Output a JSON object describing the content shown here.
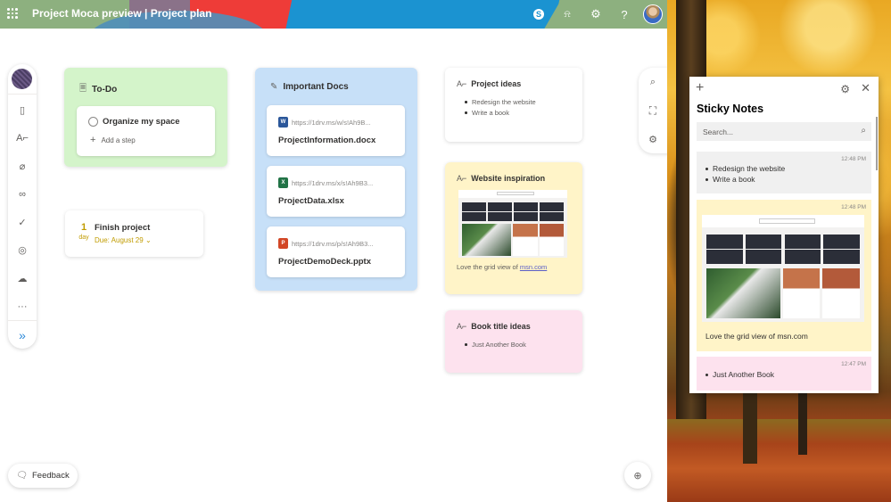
{
  "header": {
    "title": "Project Moca preview | Project plan",
    "icons": [
      "waffle-icon",
      "skype-icon",
      "bell-icon",
      "gear-icon",
      "help-icon",
      "avatar"
    ],
    "skype_glyph": "S",
    "bell_glyph": "🔔",
    "gear_glyph": "⚙",
    "help_glyph": "?"
  },
  "rail": {
    "items": [
      {
        "name": "contact-card-icon",
        "glyph": "▯"
      },
      {
        "name": "text-note-icon",
        "glyph": "A⌐"
      },
      {
        "name": "attachment-icon",
        "glyph": "⌀"
      },
      {
        "name": "link-icon",
        "glyph": "∞"
      },
      {
        "name": "task-check-icon",
        "glyph": "✓"
      },
      {
        "name": "goal-target-icon",
        "glyph": "◎"
      },
      {
        "name": "weather-icon",
        "glyph": "☁"
      },
      {
        "name": "more-icon",
        "glyph": "···"
      }
    ],
    "expand_glyph": "»"
  },
  "todo": {
    "title": "To-Do",
    "task": "Organize my space",
    "add_step": "Add a step"
  },
  "task_card": {
    "days_count": "1",
    "days_unit": "day",
    "title": "Finish project",
    "due": "Due: August 29"
  },
  "docs": {
    "title": "Important Docs",
    "items": [
      {
        "url": "https://1drv.ms/w/s!Ah9B...",
        "name": "ProjectInformation.docx",
        "type": "word",
        "color": "#2b579a",
        "letter": "W"
      },
      {
        "url": "https://1drv.ms/x/s!Ah9B3...",
        "name": "ProjectData.xlsx",
        "type": "excel",
        "color": "#217346",
        "letter": "X"
      },
      {
        "url": "https://1drv.ms/p/s!Ah9B3...",
        "name": "ProjectDemoDeck.pptx",
        "type": "powerpoint",
        "color": "#d24726",
        "letter": "P"
      }
    ]
  },
  "notes": {
    "ideas": {
      "title": "Project ideas",
      "items": [
        "Redesign the website",
        "Write a book"
      ]
    },
    "web": {
      "title": "Website inspiration",
      "caption": "Love the grid view of ",
      "link": "msn.com"
    },
    "book": {
      "title": "Book title ideas",
      "items": [
        "Just Another Book"
      ]
    }
  },
  "right_rail": {
    "search": "⌕",
    "fullscreen": "⛶",
    "settings": "⚙"
  },
  "feedback": {
    "label": "Feedback"
  },
  "sticky": {
    "title": "Sticky Notes",
    "search_placeholder": "Search...",
    "notes": [
      {
        "time": "12:48 PM",
        "items": [
          "Redesign the website",
          "Write a book"
        ],
        "color": "#f0f0f0"
      },
      {
        "time": "12:48 PM",
        "caption": "Love the grid view of msn.com",
        "color": "#fff4c8"
      },
      {
        "time": "12:47 PM",
        "items": [
          "Just Another Book"
        ],
        "color": "#fde2ee"
      }
    ]
  },
  "colors": {
    "accent": "#2b88d8",
    "todo_bg": "#d4f4ca",
    "docs_bg": "#c7e0f8",
    "yellow_note": "#fff4c8",
    "pink_note": "#fde2ee",
    "due": "#c19c00"
  }
}
